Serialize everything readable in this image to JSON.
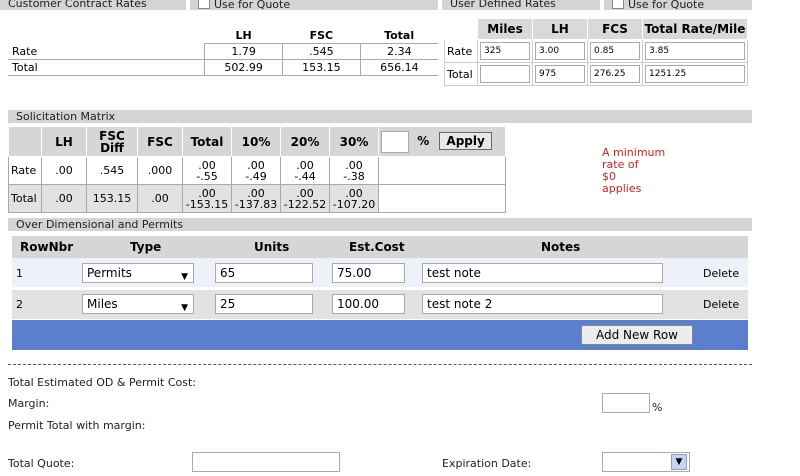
{
  "customer_contract": {
    "header": "Customer Contract Rates",
    "use_for_quote": "Use for Quote",
    "columns": [
      "LH",
      "FSC",
      "Total"
    ],
    "rows": [
      {
        "label": "Rate",
        "values": [
          "1.79",
          ".545",
          "2.34"
        ]
      },
      {
        "label": "Total",
        "values": [
          "502.99",
          "153.15",
          "656.14"
        ]
      }
    ]
  },
  "user_defined": {
    "header": "User Defined Rates",
    "use_for_quote": "Use for Quote",
    "columns": [
      "Miles",
      "LH",
      "FCS",
      "Total Rate/Mile"
    ],
    "rate_row": {
      "label": "Rate",
      "miles": "325",
      "lh": "3.00",
      "fcs": "0.85",
      "total": "3.85"
    },
    "total_row": {
      "label": "Total",
      "miles": "",
      "lh": "975",
      "fcs": "276.25",
      "total": "1251.25"
    }
  },
  "solicitation": {
    "header": "Solicitation Matrix",
    "columns": [
      "LH",
      "FSC Diff",
      "FSC",
      "Total",
      "10%",
      "20%",
      "30%"
    ],
    "percent_sign": "%",
    "apply_label": "Apply",
    "rate_row": {
      "label": "Rate",
      "lh": ".00",
      "fsc_diff": ".545",
      "fsc": ".000",
      "total": ".00\n-.55",
      "p10": ".00\n-.49",
      "p20": ".00\n-.44",
      "p30": ".00\n-.38"
    },
    "total_row": {
      "label": "Total",
      "lh": ".00",
      "fsc_diff": "153.15",
      "fsc": ".00",
      "total": ".00\n-153.15",
      "p10": ".00\n-137.83",
      "p20": ".00\n-122.52",
      "p30": ".00\n-107.20"
    },
    "notice": "A minimum\nrate of\n$0\napplies"
  },
  "over_dimensional": {
    "header": "Over Dimensional and Permits",
    "columns": {
      "rownbr": "RowNbr",
      "type": "Type",
      "units": "Units",
      "est_cost": "Est.Cost",
      "notes": "Notes"
    },
    "rows": [
      {
        "nbr": "1",
        "type": "Permits",
        "units": "65",
        "cost": "75.00",
        "notes": "test note",
        "delete": "Delete"
      },
      {
        "nbr": "2",
        "type": "Miles",
        "units": "25",
        "cost": "100.00",
        "notes": "test  note 2",
        "delete": "Delete"
      }
    ],
    "add_row_label": "Add New Row"
  },
  "summary": {
    "total_od_label": "Total Estimated OD & Permit Cost:",
    "margin_label": "Margin:",
    "margin_unit": "%",
    "permit_total_label": "Permit Total with margin:",
    "total_quote_label": "Total Quote:",
    "expiration_label": "Expiration Date:"
  }
}
